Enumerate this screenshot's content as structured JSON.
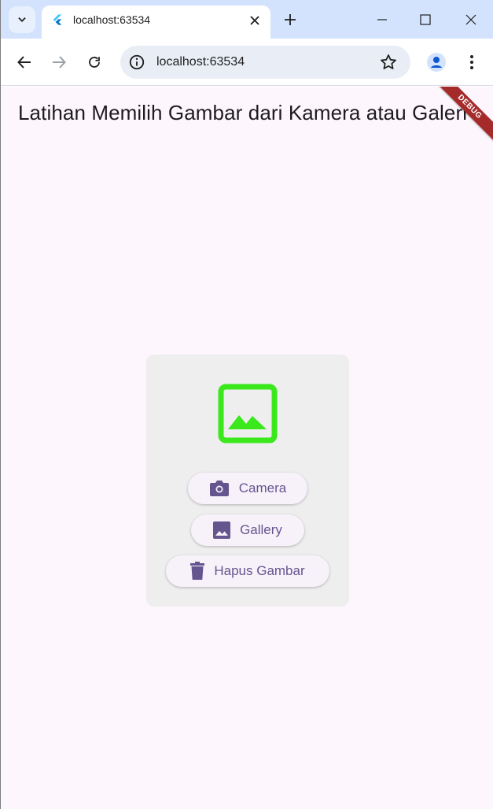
{
  "browser": {
    "tab_title": "localhost:63534",
    "url": "localhost:63534",
    "icons": {
      "tab_list": "chevron-down-icon",
      "favicon": "flutter-icon",
      "tab_close": "close-icon",
      "new_tab": "plus-icon",
      "minimize": "minimize-icon",
      "maximize": "maximize-icon",
      "close_window": "close-icon",
      "back": "arrow-left-icon",
      "forward": "arrow-right-icon",
      "reload": "reload-icon",
      "site_info": "info-icon",
      "bookmark": "star-icon",
      "profile": "account-icon",
      "menu": "more-vert-icon"
    }
  },
  "app": {
    "title": "Latihan Memilih Gambar dari Kamera atau Galeri",
    "debug_banner": "DEBUG",
    "background_color": "#fdf6fd",
    "card": {
      "placeholder_icon": "image-icon",
      "placeholder_color": "#3ae81c",
      "buttons": [
        {
          "label": "Camera",
          "icon": "camera-icon"
        },
        {
          "label": "Gallery",
          "icon": "image-icon"
        },
        {
          "label": "Hapus Gambar",
          "icon": "trash-icon"
        }
      ]
    },
    "accent_color": "#65558f"
  }
}
